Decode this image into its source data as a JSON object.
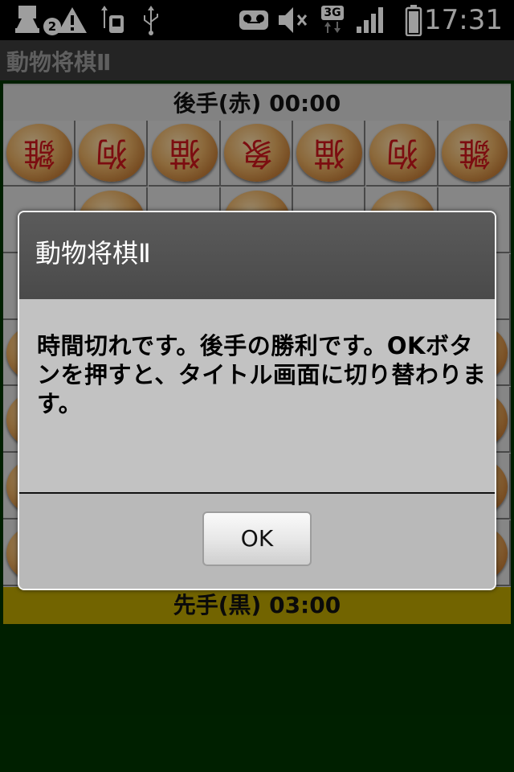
{
  "status_bar": {
    "notification_count": "2",
    "network_type": "3G",
    "time": "17:31",
    "icons": [
      "notification-stack-icon",
      "warning-icon",
      "usb-debug-icon",
      "usb-icon",
      "voicemail-icon",
      "mute-icon",
      "data-activity-icon",
      "signal-icon",
      "battery-icon"
    ]
  },
  "app": {
    "title": "動物将棋Ⅱ"
  },
  "game": {
    "gote_label": "後手(赤) 00:00",
    "sente_label": "先手(黒) 03:00",
    "top_row_glyphs": [
      "雛",
      "狗",
      "猫",
      "象",
      "猫",
      "狗",
      "雛"
    ],
    "colors": {
      "gote_bar": "#d2d2d2",
      "sente_bar": "#b8a200",
      "background": "#003300"
    }
  },
  "dialog": {
    "title": "動物将棋Ⅱ",
    "message": "時間切れです。後手の勝利です。OKボタンを押すと、タイトル画面に切り替わります。",
    "ok_label": "OK"
  }
}
